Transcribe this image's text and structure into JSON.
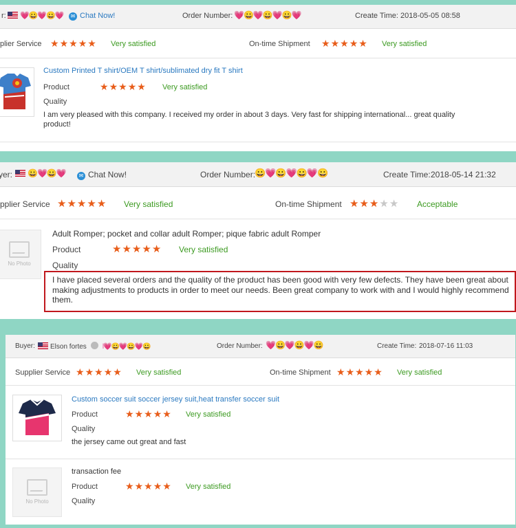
{
  "reviews": [
    {
      "buyer_label": "r:",
      "chat": "Chat Now!",
      "order_label": "Order Number:",
      "time_label": "Create Time:",
      "time": "2018-05-05 08:58",
      "supplier_label": "plier Service",
      "supplier_rating": 5,
      "supplier_text": "Very satisfied",
      "shipment_label": "On-time Shipment",
      "shipment_rating": 5,
      "shipment_text": "Very satisfied",
      "products": [
        {
          "title": "Custom Printed T shirt/OEM T shirt/sublimated dry fit T shirt",
          "product_label": "Product",
          "product_rating": 5,
          "product_text": "Very satisfied",
          "quality_label": "Quality",
          "comment": "I am very pleased with this company. I received my order in about 3 days. Very fast for shipping international... great quality product!"
        }
      ]
    },
    {
      "buyer_label": "yer:",
      "chat": "Chat Now!",
      "order_label": "Order Number:",
      "time_label": "Create Time:",
      "time": "2018-05-14 21:32",
      "supplier_label": "pplier Service",
      "supplier_rating": 5,
      "supplier_text": "Very satisfied",
      "shipment_label": "On-time Shipment",
      "shipment_rating": 3,
      "shipment_text": "Acceptable",
      "products": [
        {
          "no_photo": "No Photo",
          "title": "Adult Romper; pocket and collar adult Romper; pique fabric adult Romper",
          "product_label": "Product",
          "product_rating": 5,
          "product_text": "Very satisfied",
          "quality_label": "Quality",
          "comment": "I have placed several orders and the quality of the product has been good with very few defects. They have been great about making adjustments to products in order to meet our needs. Been great company to work with and I would highly recommend them."
        }
      ]
    },
    {
      "buyer_label": "Buyer:",
      "buyer_name": "Elson fortes",
      "order_label": "Order Number:",
      "time_label": "Create Time:",
      "time": "2018-07-16 11:03",
      "supplier_label": "Supplier Service",
      "supplier_rating": 5,
      "supplier_text": "Very satisfied",
      "shipment_label": "On-time Shipment",
      "shipment_rating": 5,
      "shipment_text": "Very satisfied",
      "products": [
        {
          "title": "Custom soccer suit soccer jersey suit,heat transfer soccer suit",
          "product_label": "Product",
          "product_rating": 5,
          "product_text": "Very satisfied",
          "quality_label": "Quality",
          "comment": "the jersey came out great and fast"
        },
        {
          "no_photo": "No Photo",
          "title": "transaction fee",
          "product_label": "Product",
          "product_rating": 5,
          "product_text": "Very satisfied",
          "quality_label": "Quality"
        }
      ]
    }
  ],
  "colors": {
    "star": "#e85d1a",
    "green": "#3c9a21",
    "link": "#2a79c0",
    "highlight": "#c0171c"
  }
}
